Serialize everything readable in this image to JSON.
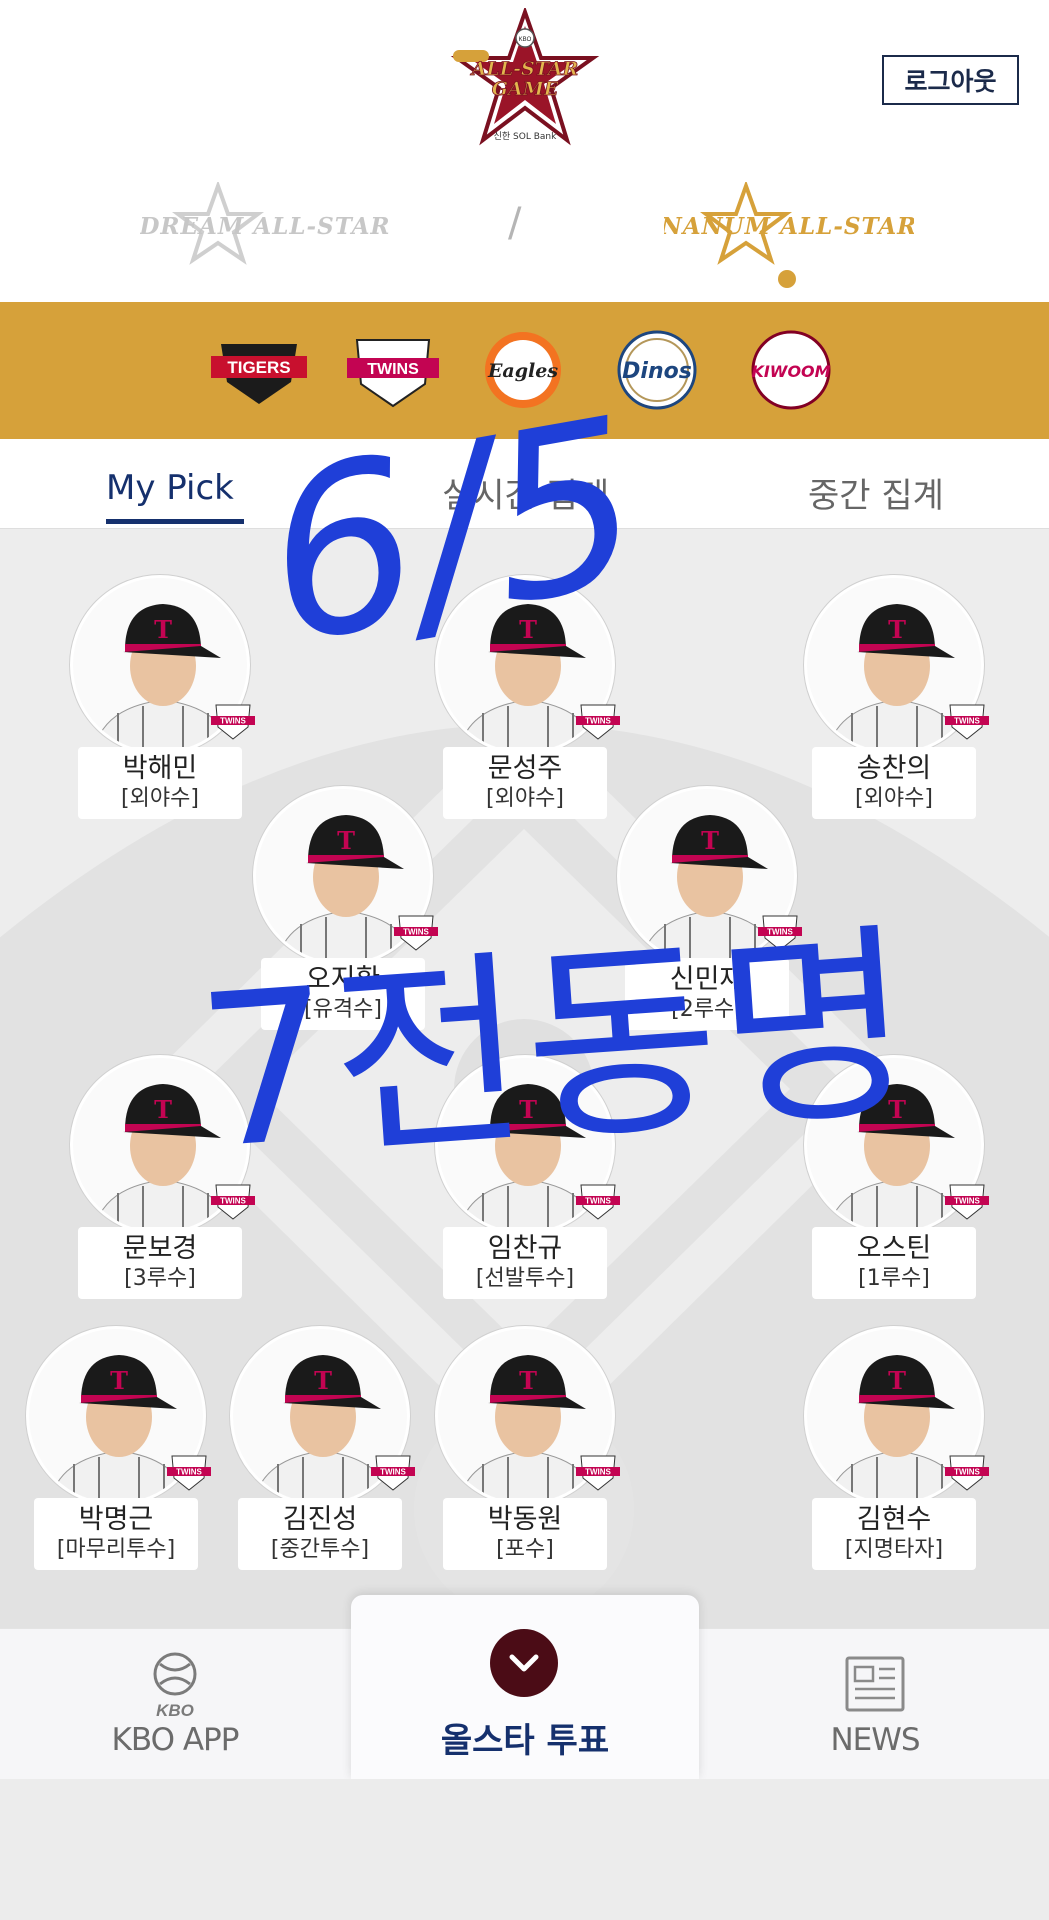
{
  "header": {
    "logo_text": [
      "ALL-STAR",
      "GAME",
      "신한 SOL Bank",
      "KBO"
    ],
    "logout_label": "로그아웃",
    "leagues": [
      {
        "label": "DREAM ALL-STAR",
        "selected": false
      },
      {
        "label": "NANUM ALL-STAR",
        "selected": true
      }
    ],
    "separator": "/"
  },
  "teams": [
    {
      "name": "TIGERS",
      "color": "#c8102e"
    },
    {
      "name": "TWINS",
      "color": "#c30452"
    },
    {
      "name": "Eagles",
      "color": "#f37321"
    },
    {
      "name": "Dinos",
      "color": "#1d467f"
    },
    {
      "name": "KIWOOM",
      "color": "#820024"
    }
  ],
  "tabs": [
    {
      "label": "My Pick",
      "active": true
    },
    {
      "label": "실시간 집계",
      "active": false
    },
    {
      "label": "중간 집계",
      "active": false
    }
  ],
  "players": [
    {
      "name": "박해민",
      "position": "[외야수]"
    },
    {
      "name": "문성주",
      "position": "[외야수]"
    },
    {
      "name": "송찬의",
      "position": "[외야수]"
    },
    {
      "name": "오지환",
      "position": "[유격수]"
    },
    {
      "name": "신민재",
      "position": "[2루수]"
    },
    {
      "name": "문보경",
      "position": "[3루수]"
    },
    {
      "name": "임찬규",
      "position": "[선발투수]"
    },
    {
      "name": "오스틴",
      "position": "[1루수]"
    },
    {
      "name": "박명근",
      "position": "[마무리투수]"
    },
    {
      "name": "김진성",
      "position": "[중간투수]"
    },
    {
      "name": "박동원",
      "position": "[포수]"
    },
    {
      "name": "김현수",
      "position": "[지명타자]"
    }
  ],
  "badge_text": "TWINS",
  "handwriting": [
    "6/5",
    "7전동명"
  ],
  "bottom_nav": {
    "kbo_app": "KBO APP",
    "kbo_logo": "KBO",
    "vote": "올스타 투표",
    "news": "NEWS"
  },
  "colors": {
    "navy": "#15306d",
    "gold": "#d6a13a",
    "maroon": "#4b0c16",
    "ink": "#1f3fd8"
  }
}
